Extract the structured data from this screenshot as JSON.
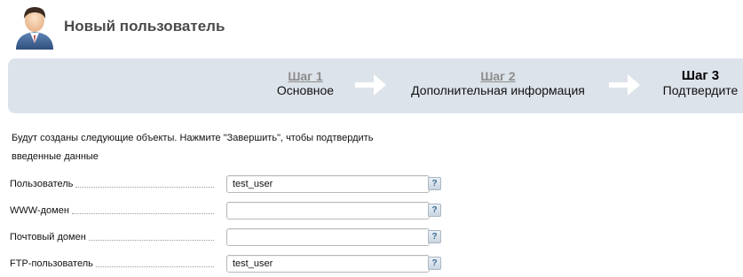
{
  "header": {
    "title": "Новый пользователь"
  },
  "wizard": {
    "steps": [
      {
        "number": "Шаг 1",
        "label": "Основное",
        "current": false
      },
      {
        "number": "Шаг 2",
        "label": "Дополнительная информация",
        "current": false
      },
      {
        "number": "Шаг 3",
        "label": "Подтвердите",
        "current": true
      }
    ]
  },
  "intro": {
    "text": "Будут созданы следующие объекты. Нажмите \"Завершить\", чтобы подтвердить введенные данные"
  },
  "form": {
    "rows": [
      {
        "label": "Пользователь",
        "value": "test_user",
        "help": "?"
      },
      {
        "label": "WWW-домен",
        "value": "",
        "help": "?"
      },
      {
        "label": "Почтовый домен",
        "value": "",
        "help": "?"
      },
      {
        "label": "FTP-пользователь",
        "value": "test_user",
        "help": "?"
      }
    ]
  },
  "icons": {
    "avatar": "user-avatar-icon",
    "arrow": "arrow-right-icon",
    "help": "question-mark-icon"
  },
  "colors": {
    "wizard_bg": "#dde3ea",
    "title": "#4a4a4a",
    "step_inactive": "#8c8c8c"
  }
}
